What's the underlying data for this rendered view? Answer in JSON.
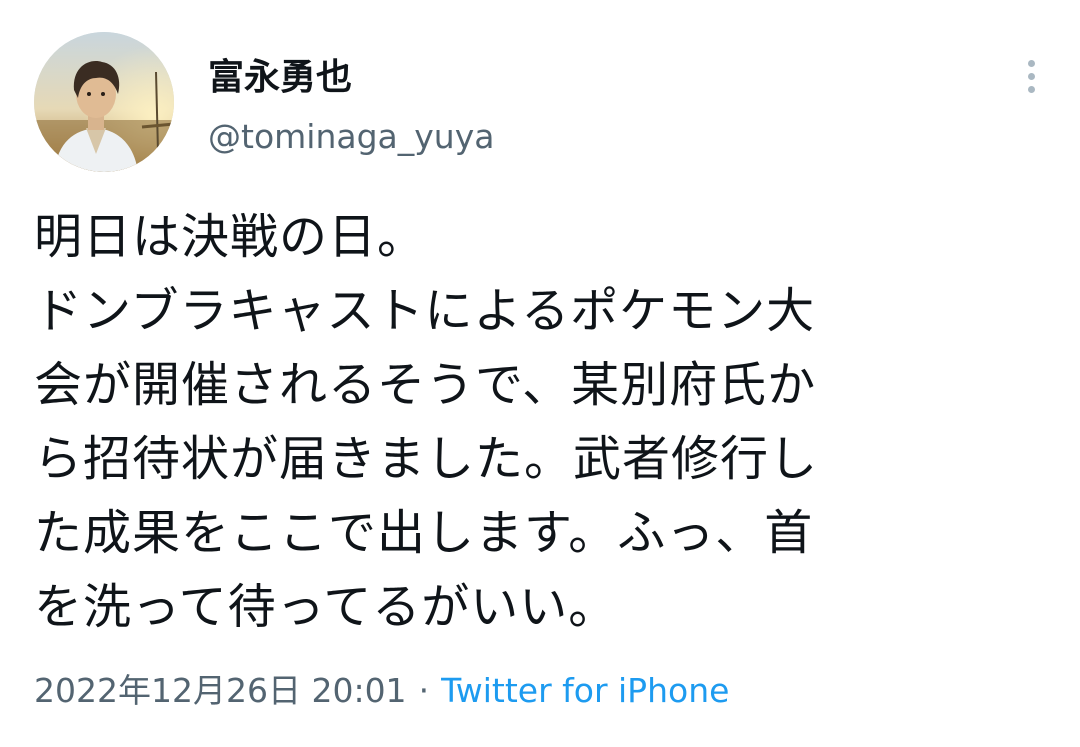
{
  "author": {
    "display_name": "富永勇也",
    "handle": "@tominaga_yuya"
  },
  "tweet": {
    "lines": [
      "明日は決戦の日。",
      "ドンブラキャストによるポケモン大",
      "会が開催されるそうで、某別府氏か",
      "ら招待状が届きました。武者修行し",
      "た成果をここで出します。ふっ、首",
      "を洗って待ってるがいい。"
    ]
  },
  "meta": {
    "timestamp": "2022年12月26日 20:01",
    "separator": "·",
    "source": "Twitter for iPhone"
  },
  "icons": {
    "more": "more-vertical-icon"
  },
  "colors": {
    "text": "#0f1419",
    "secondary": "#536471",
    "link": "#1d9bf0"
  }
}
